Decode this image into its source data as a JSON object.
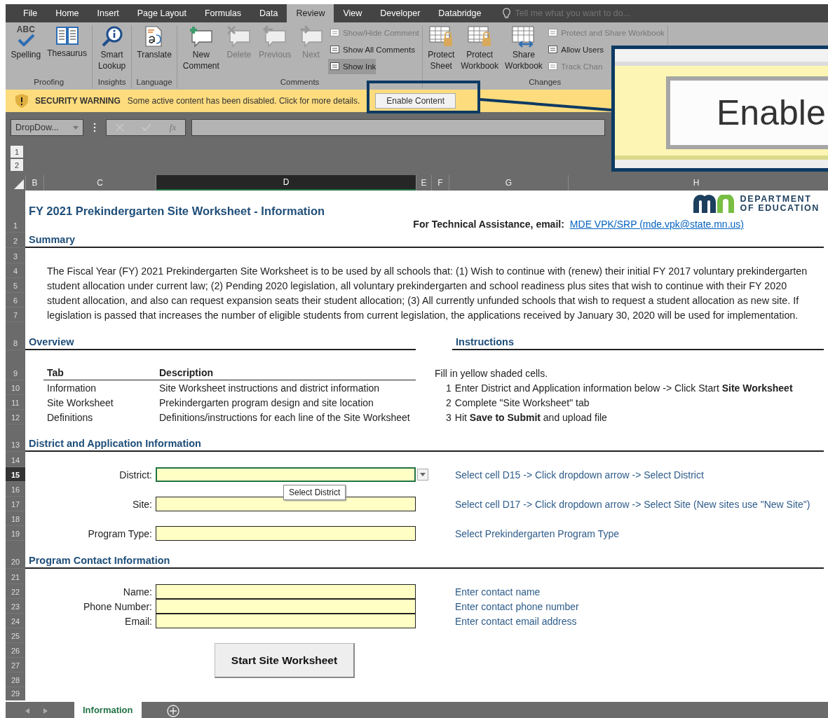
{
  "ribbon_tabs": [
    {
      "label": "File",
      "selected": false
    },
    {
      "label": "Home",
      "selected": false
    },
    {
      "label": "Insert",
      "selected": false
    },
    {
      "label": "Page Layout",
      "selected": false
    },
    {
      "label": "Formulas",
      "selected": false
    },
    {
      "label": "Data",
      "selected": false
    },
    {
      "label": "Review",
      "selected": true
    },
    {
      "label": "View",
      "selected": false
    },
    {
      "label": "Developer",
      "selected": false
    },
    {
      "label": "Databridge",
      "selected": false
    }
  ],
  "tell_me": {
    "placeholder": "Tell me what you want to do..."
  },
  "ribbon_groups": [
    {
      "label": "Proofing",
      "buttons": [
        {
          "kind": "large",
          "label": "Spelling",
          "icon_text": "ABC",
          "disabled": false
        },
        {
          "kind": "large",
          "label": "Thesaurus",
          "disabled": false
        }
      ]
    },
    {
      "label": "Insights",
      "buttons": [
        {
          "kind": "large",
          "label": "Smart Lookup",
          "disabled": false
        }
      ]
    },
    {
      "label": "Language",
      "buttons": [
        {
          "kind": "large",
          "label": "Translate",
          "disabled": false
        }
      ]
    },
    {
      "label": "Comments",
      "buttons": [
        {
          "kind": "large",
          "label": "New Comment",
          "disabled": false
        },
        {
          "kind": "large",
          "label": "Delete",
          "disabled": true
        },
        {
          "kind": "large",
          "label": "Previous",
          "disabled": true
        },
        {
          "kind": "large",
          "label": "Next",
          "disabled": true
        },
        {
          "kind": "small",
          "label": "Show/Hide Comment",
          "disabled": true,
          "pressed": false
        },
        {
          "kind": "small",
          "label": "Show All Comments",
          "disabled": false,
          "pressed": false
        },
        {
          "kind": "small",
          "label": "Show Ink",
          "disabled": false,
          "pressed": true
        }
      ]
    },
    {
      "label": "Changes",
      "buttons": [
        {
          "kind": "large",
          "label": "Protect Sheet",
          "disabled": false
        },
        {
          "kind": "large",
          "label": "Protect Workbook",
          "disabled": false
        },
        {
          "kind": "large",
          "label": "Share Workbook",
          "disabled": false
        },
        {
          "kind": "small",
          "label": "Protect and Share Workbook",
          "disabled": true,
          "pressed": false
        },
        {
          "kind": "small",
          "label": "Allow Users",
          "disabled": false,
          "pressed": false
        },
        {
          "kind": "small",
          "label": "Track Chan",
          "disabled": true,
          "pressed": false
        }
      ]
    }
  ],
  "security_bar": {
    "title": "SECURITY WARNING",
    "message": "Some active content has been disabled. Click for more details.",
    "button": "Enable Content"
  },
  "callout": {
    "label": "Enable"
  },
  "formula_bar": {
    "name_box": "DropDow...",
    "fx": "fx"
  },
  "outline_levels": [
    "1",
    "2"
  ],
  "columns": [
    {
      "label": "B",
      "selected": false
    },
    {
      "label": "C",
      "selected": false
    },
    {
      "label": "D",
      "selected": true
    },
    {
      "label": "E",
      "selected": false
    },
    {
      "label": "F",
      "selected": false
    },
    {
      "label": "G",
      "selected": false
    },
    {
      "label": "H",
      "selected": false
    }
  ],
  "row_headers": [
    {
      "label": "1",
      "selected": false
    },
    {
      "label": "2",
      "selected": false
    },
    {
      "label": "3",
      "selected": false
    },
    {
      "label": "4",
      "selected": false
    },
    {
      "label": "5",
      "selected": false
    },
    {
      "label": "6",
      "selected": false
    },
    {
      "label": "7",
      "selected": false
    },
    {
      "label": "8",
      "selected": false
    },
    {
      "label": "9",
      "selected": false
    },
    {
      "label": "10",
      "selected": false
    },
    {
      "label": "11",
      "selected": false
    },
    {
      "label": "12",
      "selected": false
    },
    {
      "label": "13",
      "selected": false
    },
    {
      "label": "14",
      "selected": false
    },
    {
      "label": "15",
      "selected": true
    },
    {
      "label": "16",
      "selected": false
    },
    {
      "label": "17",
      "selected": false
    },
    {
      "label": "18",
      "selected": false
    },
    {
      "label": "19",
      "selected": false
    },
    {
      "label": "20",
      "selected": false
    },
    {
      "label": "21",
      "selected": false
    },
    {
      "label": "22",
      "selected": false
    },
    {
      "label": "23",
      "selected": false
    },
    {
      "label": "24",
      "selected": false
    },
    {
      "label": "25",
      "selected": false
    },
    {
      "label": "26",
      "selected": false
    },
    {
      "label": "27",
      "selected": false
    },
    {
      "label": "28",
      "selected": false
    },
    {
      "label": "29",
      "selected": false
    }
  ],
  "sheet": {
    "title": "FY 2021 Prekindergarten Site Worksheet - Information",
    "logo": {
      "line1": "DEPARTMENT",
      "line2": "OF EDUCATION"
    },
    "tech_assistance": {
      "label": "For Technical Assistance, email:",
      "link": "MDE VPK/SRP (mde.vpk@state.mn.us)"
    },
    "summary": {
      "heading": "Summary",
      "lines": [
        "The Fiscal Year (FY) 2021 Prekindergarten Site Worksheet is to be used by all schools that: (1) Wish to continue with (renew) their initial FY 2017 voluntary prekindergarten",
        "student allocation under current law; (2) Pending 2020 legislation, all voluntary prekindergarten and school readiness plus sites that wish to continue with their FY 2020",
        "student allocation, and also can request expansion seats their student allocation; (3) All currently unfunded schools that wish to request a student allocation as new site. If",
        "legislation is passed that increases the number of eligible students from current legislation, the applications received by January 30, 2020 will be used for implementation."
      ]
    },
    "overview": {
      "heading": "Overview",
      "columns": [
        "Tab",
        "Description"
      ],
      "rows": [
        [
          "Information",
          "Site Worksheet instructions and district information"
        ],
        [
          "Site Worksheet",
          "Prekindergarten program design and site location"
        ],
        [
          "Definitions",
          "Definitions/instructions for each line of the Site Worksheet"
        ]
      ]
    },
    "instructions": {
      "heading": "Instructions",
      "intro": "Fill in yellow shaded cells.",
      "steps": [
        {
          "number": "1",
          "text": "Enter District and Application information below -> Click Start **Site Worksheet**"
        },
        {
          "number": "2",
          "text": "Complete \"Site Worksheet\" tab"
        },
        {
          "number": "3",
          "text": "Hit **Save to Submit** and upload file"
        }
      ]
    },
    "district": {
      "heading": "District and Application Information",
      "tooltip": "Select District",
      "fields": [
        {
          "label": "District:",
          "hint": "Select cell D15 -> Click dropdown arrow -> Select District",
          "selected": true
        },
        {
          "label": "Site:",
          "hint": "Select cell D17 -> Click dropdown arrow -> Select Site (New sites use \"New Site\")",
          "selected": false
        },
        {
          "label": "Program Type:",
          "hint": "Select Prekindergarten Program Type",
          "selected": false
        }
      ]
    },
    "contact": {
      "heading": "Program Contact Information",
      "fields": [
        {
          "label": "Name:",
          "hint": "Enter contact name",
          "selected": false
        },
        {
          "label": "Phone Number:",
          "hint": "Enter contact phone number",
          "selected": false
        },
        {
          "label": "Email:",
          "hint": "Enter contact email address",
          "selected": false
        }
      ]
    },
    "start_button": "Start Site Worksheet"
  },
  "sheet_tabs": [
    {
      "label": "Information",
      "selected": true
    }
  ]
}
